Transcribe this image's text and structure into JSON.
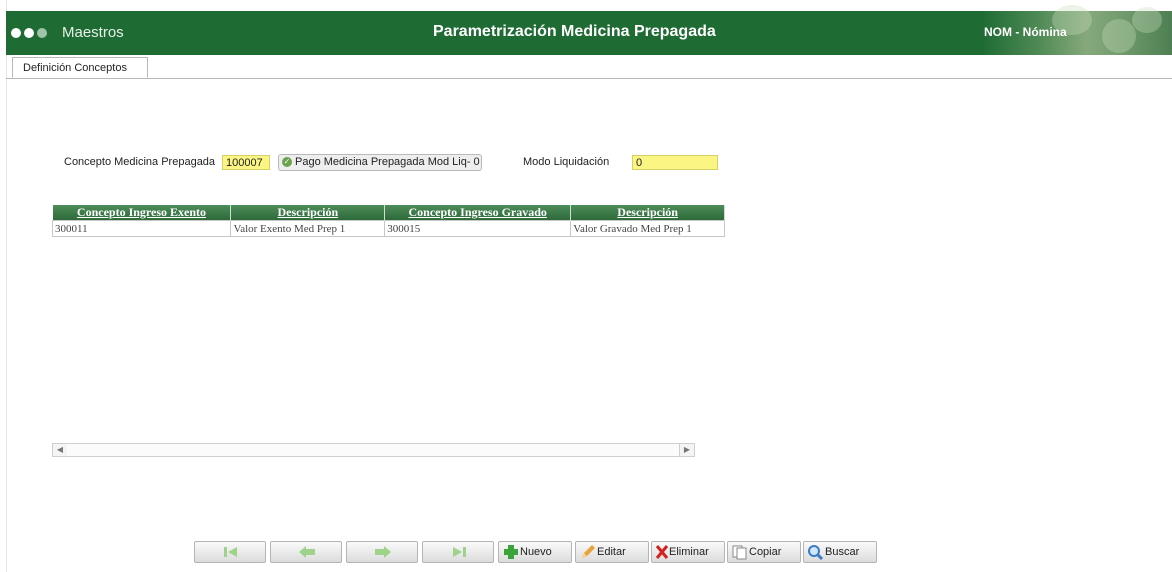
{
  "header": {
    "menu_title": "Maestros",
    "app_title": "Parametrización Medicina Prepagada",
    "module": "NOM - Nómina",
    "colors": {
      "bar": "#1f6b34",
      "accent_field": "#fbf584"
    }
  },
  "tabs": [
    {
      "label": "Definición Conceptos"
    }
  ],
  "form": {
    "concept_label": "Concepto Medicina Prepagada",
    "concept_code": "100007",
    "concept_desc": "Pago Medicina Prepagada Mod Liq- 0",
    "mode_label": "Modo Liquidación",
    "mode_value": "0"
  },
  "table": {
    "headers": [
      "Concepto Ingreso Exento",
      "Descripción",
      "Concepto Ingreso Gravado",
      "Descripción"
    ],
    "rows": [
      [
        "300011",
        "Valor Exento Med Prep 1",
        "300015",
        "Valor Gravado Med Prep 1"
      ]
    ]
  },
  "toolbar": {
    "icons": [
      "first-icon",
      "prev-icon",
      "next-icon",
      "last-icon"
    ],
    "new_label": "Nuevo",
    "edit_label": "Editar",
    "delete_label": "Eliminar",
    "copy_label": "Copiar",
    "search_label": "Buscar"
  }
}
